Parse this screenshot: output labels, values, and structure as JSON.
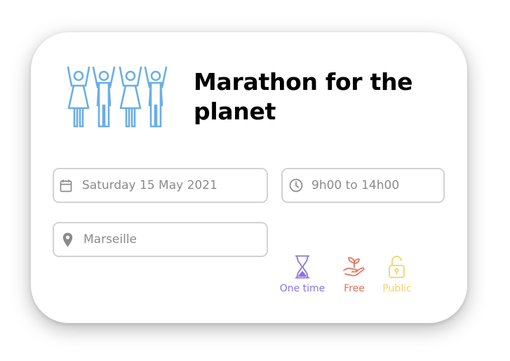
{
  "event": {
    "title": "Marathon for the planet",
    "date": "Saturday 15 May 2021",
    "time": "9h00 to 14h00",
    "location": "Marseille"
  },
  "badges": [
    {
      "label": "One time",
      "icon": "hourglass-icon",
      "color": "#8b73e0"
    },
    {
      "label": "Free",
      "icon": "hand-sprout-icon",
      "color": "#e8705a"
    },
    {
      "label": "Public",
      "icon": "unlocked-padlock-icon",
      "color": "#f1d56a"
    }
  ],
  "icons": {
    "people": "people-arms-raised-icon",
    "date": "calendar-icon",
    "time": "clock-icon",
    "location": "location-pin-icon"
  },
  "colors": {
    "people_icon": "#6aaee6",
    "field_border": "#d2d2d2",
    "field_text": "#8a8a8a"
  }
}
